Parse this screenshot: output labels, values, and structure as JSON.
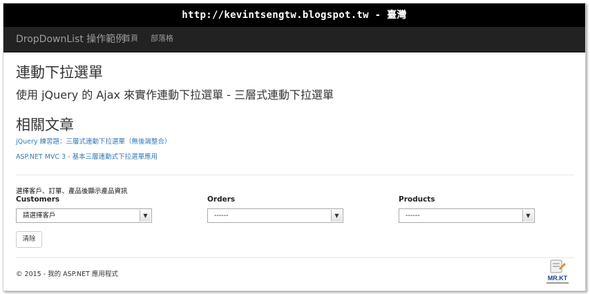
{
  "url_bar": {
    "text": "http://kevintsengtw.blogspot.tw - 臺灣"
  },
  "navbar": {
    "brand": "DropDownList 操作範例",
    "links": [
      {
        "label": "首頁"
      },
      {
        "label": "部落格"
      }
    ]
  },
  "main": {
    "title": "連動下拉選單",
    "subtitle": "使用 jQuery 的 Ajax 來實作連動下拉選單 - 三層式連動下拉選單",
    "related_heading": "相關文章",
    "related_links": [
      {
        "label": "jQuery 練習題：三層式連動下拉選單（無後端整合）"
      },
      {
        "label": "ASP.NET MVC 3 - 基本三層連動式下拉選單應用"
      }
    ],
    "instruction": "選擇客戶、訂單、產品後顯示產品資訊",
    "fields": [
      {
        "label": "Customers",
        "value": "請選擇客戶"
      },
      {
        "label": "Orders",
        "value": "------"
      },
      {
        "label": "Products",
        "value": "------"
      }
    ],
    "clear_button": "清除"
  },
  "footer": {
    "text": "© 2015 - 我的 ASP.NET 應用程式"
  },
  "logo": {
    "text": "MR.KT",
    "icon": "mr-kt-logo",
    "accent": "#1a3f8f"
  },
  "colors": {
    "navbar_bg": "#222222",
    "link": "#337ab7"
  }
}
